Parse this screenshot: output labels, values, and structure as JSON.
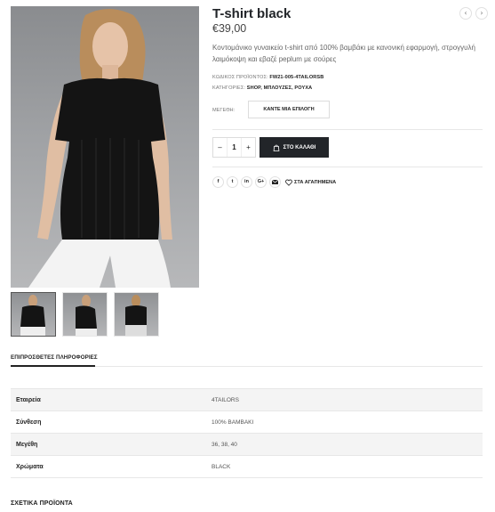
{
  "product": {
    "title": "T-shirt black",
    "price": "€39,00",
    "description": "Κοντομάνικο γυναικείο t-shirt από 100% βαμβάκι με κανονική εφαρμογή, στρογγυλή λαιμόκοψη και εβαζέ peplum με σούρες",
    "code_label": "ΚΩΔΙΚΟΣ ΠΡΟΪΟΝΤΟΣ:",
    "code_value": "FW21-005-4TAILORSB",
    "categories_label": "ΚΑΤΗΓΟΡΙΕΣ:",
    "categories_value": "SHOP, ΜΠΛΟΥΖΕΣ, ΡΟΥΧΑ"
  },
  "nav": {
    "prev_icon": "‹",
    "next_icon": "›"
  },
  "size": {
    "label": "ΜΕΓΕΘΗ:",
    "select_value": "ΚΑΝΤΕ ΜΙΑ ΕΠΙΛΟΓΗ"
  },
  "quantity": {
    "minus": "–",
    "value": "1",
    "plus": "+"
  },
  "cart": {
    "label": "ΣΤΟ ΚΑΛΑΘΙ",
    "icon": "bag-icon"
  },
  "share": {
    "icons": [
      "f",
      "t",
      "in",
      "G+",
      "mail-icon"
    ],
    "wishlist_label": "ΣΤΑ ΑΓΑΠΗΜΕΝΑ"
  },
  "tabs": {
    "additional_info": "ΕΠΙΠΡΟΣΘΕΤΕΣ ΠΛΗΡΟΦΟΡΙΕΣ"
  },
  "info_table": [
    {
      "label": "Εταιρεία",
      "value": "4TAILORS"
    },
    {
      "label": "Σύνθεση",
      "value": "100% ΒΑΜΒΑΚΙ"
    },
    {
      "label": "Μεγέθη",
      "value": "36, 38, 40"
    },
    {
      "label": "Χρώματα",
      "value": "BLACK"
    }
  ],
  "related": {
    "title": "ΣΧΕΤΙΚΑ ΠΡΟΪΟΝΤΑ"
  },
  "colors": {
    "dark": "#222529",
    "border": "#e7e7e7",
    "row_alt": "#f4f4f4"
  }
}
